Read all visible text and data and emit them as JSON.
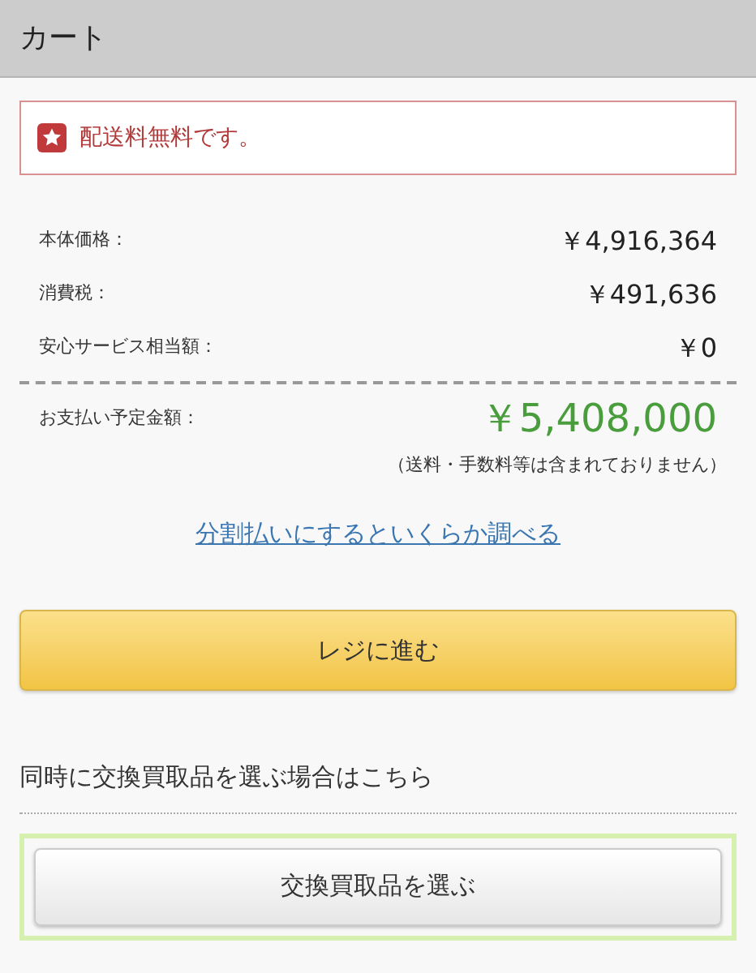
{
  "header": {
    "title": "カート"
  },
  "notice": {
    "text": "配送料無料です。"
  },
  "price_rows": [
    {
      "label": "本体価格：",
      "value": "￥4,916,364"
    },
    {
      "label": "消費税：",
      "value": "￥491,636"
    },
    {
      "label": "安心サービス相当額：",
      "value": "￥0"
    }
  ],
  "total": {
    "label": "お支払い予定金額：",
    "value": "￥5,408,000",
    "note": "（送料・手数料等は含まれておりません）"
  },
  "installment_link": "分割払いにするといくらか調べる",
  "checkout_button": "レジに進む",
  "trade_in": {
    "heading": "同時に交換買取品を選ぶ場合はこちら",
    "button": "交換買取品を選ぶ"
  }
}
